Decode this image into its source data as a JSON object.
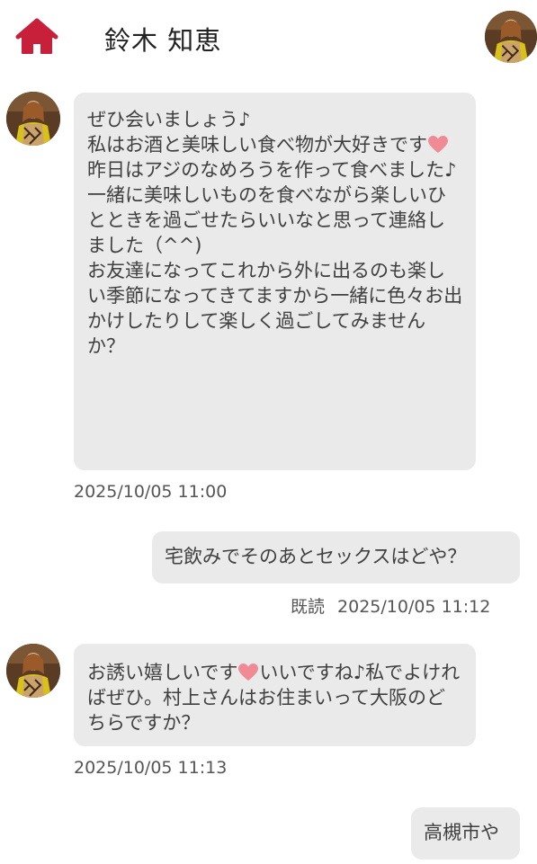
{
  "header": {
    "name": "鈴木 知恵",
    "home_icon_color": "#c8203a"
  },
  "messages": [
    {
      "side": "received",
      "parts": [
        "ぜひ会いましょう♪\n私はお酒と美味しい食べ物が大好きです",
        "\n昨日はアジのなめろうを作って食べました♪\n一緒に美味しいものを食べながら楽しいひとときを過ごせたらいいなと思って連絡しました（^^)\nお友達になってこれから外に出るのも楽しい季節になってきてますから一緒に色々お出かけしたりして楽しく過ごしてみませんか？"
      ],
      "timestamp": "2025/10/05 11:00"
    },
    {
      "side": "sent",
      "text": "宅飲みでそのあとセックスはどや？",
      "read_label": "既読",
      "timestamp": "2025/10/05 11:12"
    },
    {
      "side": "received",
      "parts": [
        "お誘い嬉しいです",
        "いいですね♪私でよければぜひ。村上さんはお住まいって大阪のどちらですか？"
      ],
      "timestamp": "2025/10/05 11:13"
    },
    {
      "side": "sent",
      "text": "高槻市や"
    }
  ],
  "colors": {
    "bubble": "#eaeaea",
    "heart": "#f08a95",
    "accent": "#c8203a"
  }
}
